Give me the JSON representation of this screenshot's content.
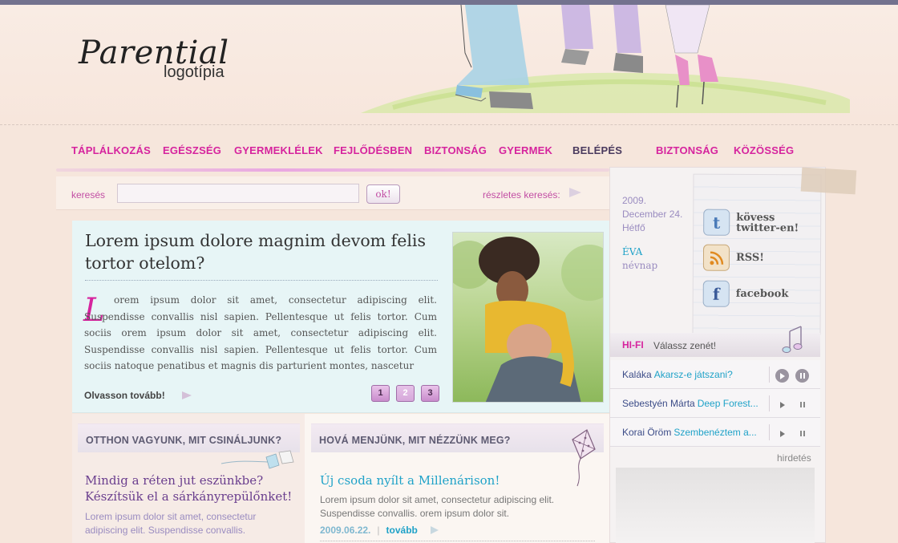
{
  "logo": {
    "main": "Parential",
    "sub": "logotípia"
  },
  "nav": [
    {
      "label": "TÁPLÁLKOZÁS"
    },
    {
      "label": "EGÉSZSÉG"
    },
    {
      "label": "GYERMEKLÉLEK"
    },
    {
      "label": "FEJLŐDÉSBEN"
    },
    {
      "label": "BIZTONSÁG"
    },
    {
      "label": "GYERMEK"
    },
    {
      "label": "BELÉPÉS"
    },
    {
      "label": "BIZTONSÁG"
    },
    {
      "label": "KÖZÖSSÉG"
    }
  ],
  "search": {
    "label": "keresés",
    "value": "",
    "button": "ok!",
    "advanced": "részletes keresés:"
  },
  "feature": {
    "title": "Lorem ipsum dolore magnim devom felis tortor otelom?",
    "dropcap": "L",
    "text": "orem ipsum dolor sit amet, consectetur adipiscing elit. Suspendisse convallis nisl sapien. Pellentesque ut felis tortor. Cum sociis orem ipsum dolor sit amet, consectetur adipiscing elit. Suspendisse convallis nisl sapien. Pellentesque ut felis tortor. Cum sociis natoque penatibus et magnis dis parturient montes, nascetur",
    "read_more": "Olvasson tovább!",
    "pages": [
      "1",
      "2",
      "3"
    ],
    "active_page": "2"
  },
  "box1": {
    "heading": "OTTHON VAGYUNK, MIT CSINÁLJUNK?",
    "title": "Mindig a réten jut eszünkbe? Készítsük el a sárkányrepülőnket!",
    "text": "Lorem ipsum dolor sit amet, consectetur adipiscing elit. Suspendisse convallis."
  },
  "box2": {
    "heading": "HOVÁ MENJÜNK, MIT NÉZZÜNK MEG?",
    "title": "Új csoda nyílt a Millenárison!",
    "text": "Lorem ipsum dolor sit amet, consectetur adipiscing elit. Suspendisse convallis. orem ipsum dolor sit.",
    "date": "2009.06.22.",
    "more": "tovább"
  },
  "sidebar": {
    "date_year": "2009.",
    "date_day": "December 24.",
    "date_weekday": "Hétfő",
    "nameday_name": "ÉVA",
    "nameday_label": "névnap",
    "social": [
      {
        "label": "kövess twitter-en!",
        "icon": "twitter-icon",
        "glyph": "t"
      },
      {
        "label": "RSS!",
        "icon": "rss-icon",
        "glyph": ""
      },
      {
        "label": "facebook",
        "icon": "facebook-icon",
        "glyph": "f"
      }
    ],
    "hifi_label": "HI-FI",
    "hifi_sub": "Válassz zenét!",
    "songs": [
      {
        "artist": "Kaláka",
        "title": "Akarsz-e játszani?"
      },
      {
        "artist": "Sebestyén Márta",
        "title": "Deep Forest..."
      },
      {
        "artist": "Korai Öröm",
        "title": "Szembenéztem a..."
      }
    ],
    "ad_label": "hirdetés"
  },
  "colors": {
    "accent": "#d6249e",
    "link": "#1fa2c8",
    "topbar": "#73728e"
  }
}
